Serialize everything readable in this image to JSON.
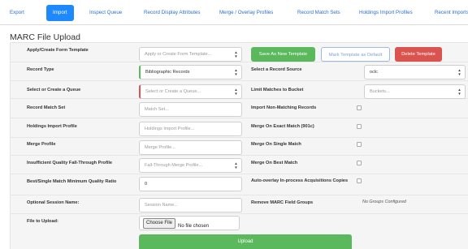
{
  "tabs": [
    {
      "label": "Export"
    },
    {
      "label": "Import"
    },
    {
      "label": "Inspect Queue"
    },
    {
      "label": "Record Display Attributes"
    },
    {
      "label": "Merge / Overlay Profiles"
    },
    {
      "label": "Record Match Sets"
    },
    {
      "label": "Holdings Import Profiles"
    },
    {
      "label": "Recent Imports"
    }
  ],
  "page_title": "MARC File Upload",
  "form": {
    "template": {
      "label": "Apply/Create Form Template",
      "placeholder": "Apply or Create Form Template..."
    },
    "buttons": {
      "save_new": "Save As New Template",
      "mark_default": "Mark Template as Default",
      "delete": "Delete Template"
    },
    "record_type": {
      "label": "Record Type",
      "value": "Bibliographic Records"
    },
    "record_source": {
      "label": "Select a Record Source",
      "value": "oclc"
    },
    "queue": {
      "label": "Select or Create a Queue",
      "placeholder": "Select or Create a Queue..."
    },
    "limit_bucket": {
      "label": "Limit Matches to Bucket",
      "placeholder": "Buckets..."
    },
    "match_set": {
      "label": "Record Match Set",
      "placeholder": "Match Set..."
    },
    "import_non_matching": {
      "label": "Import Non-Matching Records"
    },
    "holdings_profile": {
      "label": "Holdings Import Profile",
      "placeholder": "Holdings Import Profile..."
    },
    "merge_exact": {
      "label": "Merge On Exact Match (901c)"
    },
    "merge_profile": {
      "label": "Merge Profile",
      "placeholder": "Merge Profile..."
    },
    "merge_single": {
      "label": "Merge On Single Match"
    },
    "insufficient": {
      "label": "Insufficient Quality Fall-Through Profile",
      "placeholder": "Fall-Through Merge Profile..."
    },
    "merge_best": {
      "label": "Merge On Best Match"
    },
    "min_quality": {
      "label": "Best/Single Match Minimum Quality Ratio",
      "value": "0"
    },
    "auto_overlay": {
      "label": "Auto-overlay In-process Acquisitions Copies"
    },
    "session_name": {
      "label": "Optional Session Name:",
      "placeholder": "Session Name..."
    },
    "remove_fields": {
      "label": "Remove MARC Field Groups",
      "note": "No Groups Configured"
    },
    "file_upload": {
      "label": "File to Upload:",
      "button": "Choose File",
      "file": "No file chosen"
    },
    "upload_button": "Upload"
  },
  "colors": {
    "accent": "#1e88ff",
    "green": "#5cb85c",
    "red": "#d9534f",
    "link": "#2a6fd6"
  }
}
